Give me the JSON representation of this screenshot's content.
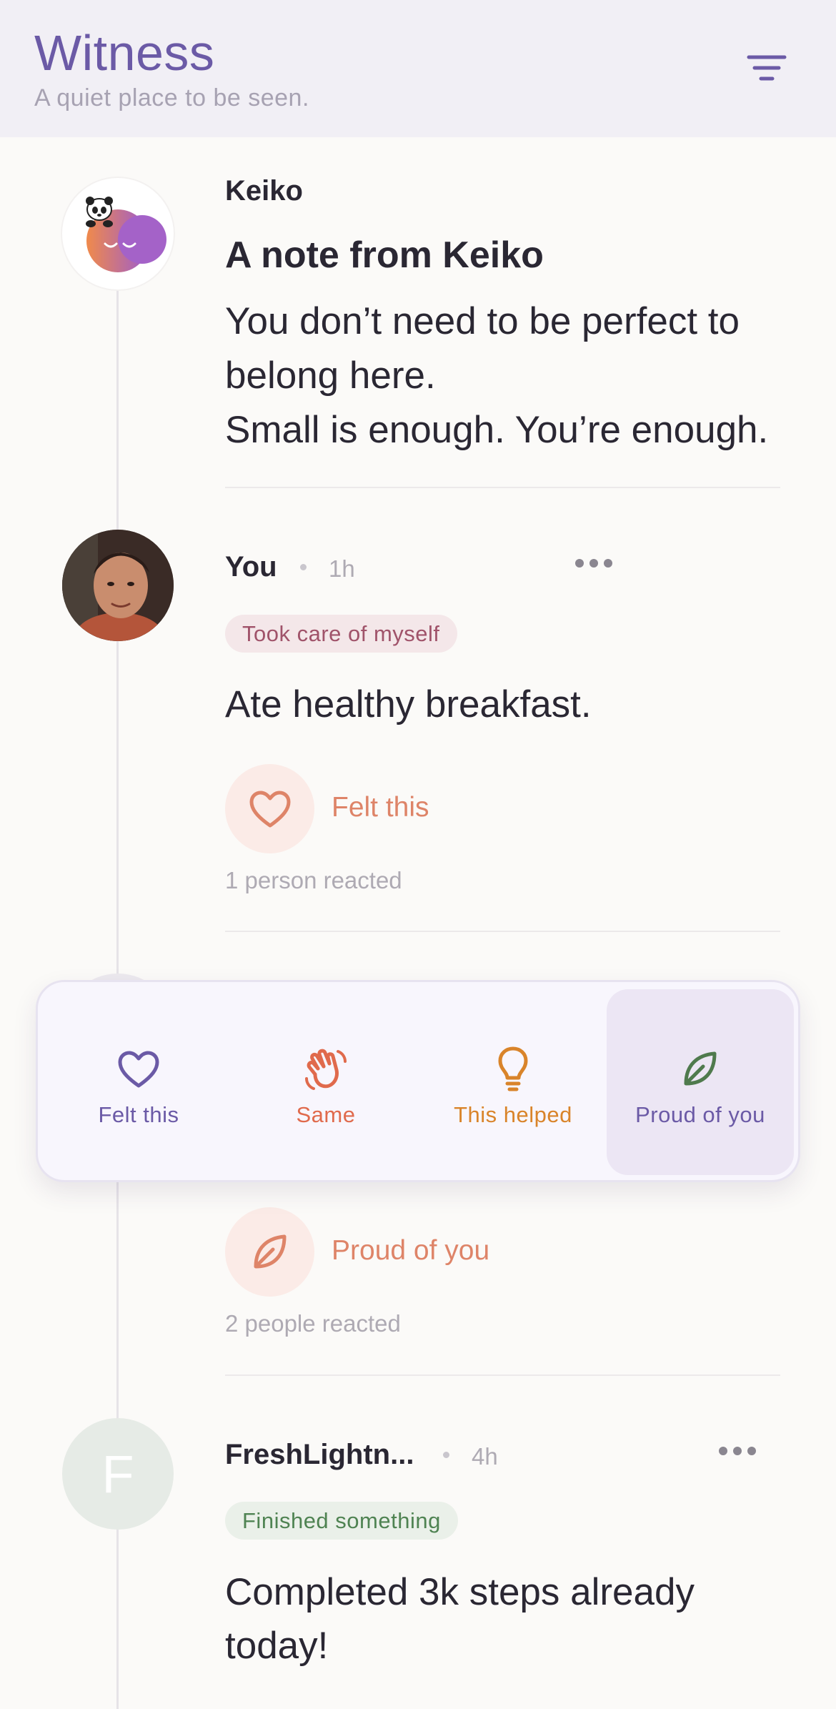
{
  "header": {
    "title": "Witness",
    "subtitle": "A quiet place to be seen.",
    "filter_icon": "filter-icon"
  },
  "note": {
    "author": "Keiko",
    "title": "A note from Keiko",
    "body_line1": "You don’t need to be perfect to",
    "body_line2": "belong here.",
    "body_line3": "Small is enough. You’re enough."
  },
  "posts": [
    {
      "author": "You",
      "time": "1h",
      "tag": "Took care of myself",
      "text": "Ate healthy breakfast.",
      "reaction_label": "Felt this",
      "reaction_icon": "heart-icon",
      "reaction_count": "1 person reacted"
    },
    {
      "reaction_label": "Proud of you",
      "reaction_icon": "leaf-icon",
      "reaction_count": "2 people reacted"
    },
    {
      "author": "FreshLightn...",
      "avatar_initial": "F",
      "time": "4h",
      "tag": "Finished something",
      "text_line1": "Completed 3k steps already",
      "text_line2": "today!"
    }
  ],
  "reaction_picker": {
    "options": [
      {
        "label": "Felt this",
        "icon": "heart-icon",
        "color": "#6b5aa6"
      },
      {
        "label": "Same",
        "icon": "wave-hand-icon",
        "color": "#e06a4c"
      },
      {
        "label": "This helped",
        "icon": "lightbulb-icon",
        "color": "#d9842a"
      },
      {
        "label": "Proud of you",
        "icon": "leaf-icon",
        "color": "#6b5aa6",
        "selected": true
      }
    ]
  },
  "colors": {
    "accent": "#6b5aa6",
    "reaction": "#de8468",
    "background": "#fbfaf8"
  }
}
